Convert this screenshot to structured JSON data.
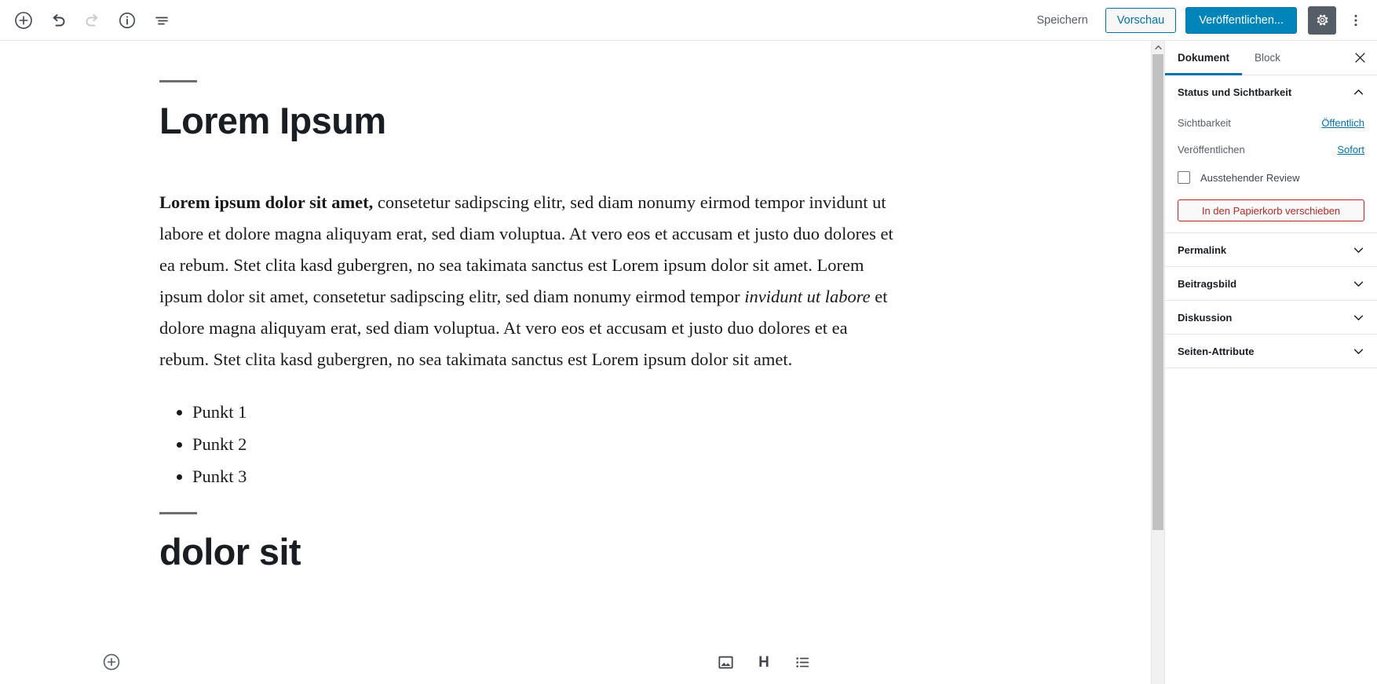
{
  "topbar": {
    "left_icons": [
      {
        "name": "add-block-icon",
        "label": "Block hinzufügen"
      },
      {
        "name": "undo-icon",
        "label": "Rückgängig"
      },
      {
        "name": "redo-icon",
        "label": "Wiederholen"
      },
      {
        "name": "info-icon",
        "label": "Inhaltsstruktur"
      },
      {
        "name": "block-navigation-icon",
        "label": "Block-Navigation"
      }
    ],
    "save_label": "Speichern",
    "preview_label": "Vorschau",
    "publish_label": "Veröffentlichen...",
    "settings_icon": "gear-icon",
    "more_icon": "ellipsis-vertical-icon",
    "accent_blue": "#0085ba",
    "link_blue": "#0073aa"
  },
  "editor": {
    "title": "Lorem Ipsum",
    "paragraph": {
      "bold_lead": "Lorem ipsum dolor sit amet,",
      "part1": " consetetur sadipscing elitr, sed diam nonumy eirmod tempor invidunt ut labore et dolore magna aliquyam erat, sed diam voluptua. At vero eos et accusam et justo duo dolores et ea rebum. Stet clita kasd gubergren, no sea takimata sanctus est Lorem ipsum dolor sit amet. Lorem ipsum dolor sit amet, consetetur sadipscing elitr, sed diam nonumy eirmod tempor ",
      "italic_part": "invidunt ut labore",
      "part2": " et dolore magna aliquyam erat, sed diam voluptua. At vero eos et accusam et justo duo dolores et ea rebum. Stet clita kasd gubergren, no sea takimata sanctus est Lorem ipsum dolor sit amet."
    },
    "list_items": [
      "Punkt 1",
      "Punkt 2",
      "Punkt 3"
    ],
    "title2": "dolor sit",
    "bottom_inserter_icon": "add-block-circle-icon",
    "quick_blocks": [
      {
        "name": "image-block-icon",
        "label": "Bild"
      },
      {
        "name": "heading-block-icon",
        "label": "H"
      },
      {
        "name": "list-block-icon",
        "label": "Liste"
      }
    ]
  },
  "sidebar": {
    "tabs": [
      {
        "label": "Dokument",
        "active": true
      },
      {
        "label": "Block",
        "active": false
      }
    ],
    "close_icon": "close-icon",
    "status_panel": {
      "title": "Status und Sichtbarkeit",
      "expanded": true,
      "visibility_label": "Sichtbarkeit",
      "visibility_value": "Öffentlich",
      "publish_label": "Veröffentlichen",
      "publish_value": "Sofort",
      "pending_review_label": "Ausstehender Review",
      "pending_review_checked": false,
      "trash_label": "In den Papierkorb verschieben",
      "trash_color": "#b52727"
    },
    "panels": [
      {
        "title": "Permalink",
        "expanded": false
      },
      {
        "title": "Beitragsbild",
        "expanded": false
      },
      {
        "title": "Diskussion",
        "expanded": false
      },
      {
        "title": "Seiten-Attribute",
        "expanded": false
      }
    ]
  }
}
